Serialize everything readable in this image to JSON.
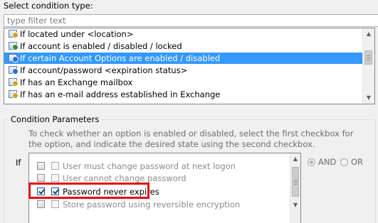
{
  "condition_type": {
    "section_label": "Select condition type:",
    "filter_placeholder": "type filter text",
    "items": [
      {
        "label": "If located under <location>",
        "icon": "folder-icon"
      },
      {
        "label": "If account is enabled / disabled / locked",
        "icon": "account-status-icon"
      },
      {
        "label": "If certain Account Options are enabled / disabled",
        "icon": "account-options-icon",
        "selected": true
      },
      {
        "label": "If account/password <expiration status>",
        "icon": "clock-icon"
      },
      {
        "label": "If has an Exchange mailbox",
        "icon": "mailbox-icon"
      },
      {
        "label": "If has an e-mail address established in Exchange",
        "icon": "email-icon"
      }
    ]
  },
  "parameters": {
    "group_label": "Condition Parameters",
    "hint": "To check whether an option is enabled or disabled, select the first checkbox for the option, and indicate the desired state using the second checkbox.",
    "if_label": "If",
    "options": [
      {
        "label": "User must change password at next logon",
        "first_checked": false,
        "second_checked": false
      },
      {
        "label": "User cannot change password",
        "first_checked": false,
        "second_checked": false
      },
      {
        "label": "Password never expires",
        "first_checked": true,
        "second_checked": true
      },
      {
        "label": "Store password using reversible encryption",
        "first_checked": false,
        "second_checked": false
      }
    ],
    "logic": {
      "and_label": "AND",
      "or_label": "OR",
      "selected": "AND"
    }
  },
  "colors": {
    "selection": "#3399ff",
    "highlight_box": "#e30b17"
  }
}
